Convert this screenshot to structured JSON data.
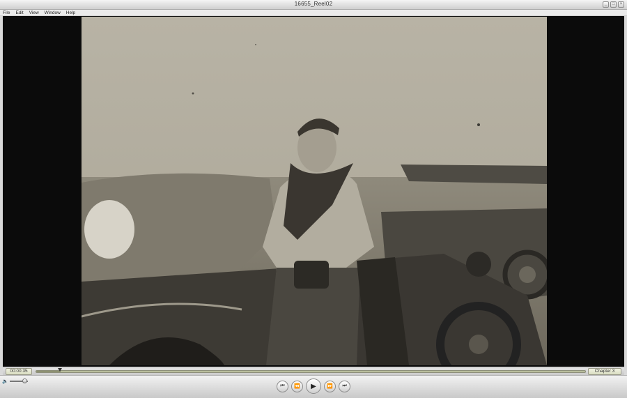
{
  "window": {
    "title": "16655_Reel02"
  },
  "title_controls": [
    "_",
    "□",
    "×"
  ],
  "menu": [
    "File",
    "Edit",
    "View",
    "Window",
    "Help"
  ],
  "playback": {
    "current_time": "00:00:35",
    "progress": 0.044,
    "chapter": "Chapter 3"
  },
  "volume": {
    "level": 0.85
  },
  "transport": {
    "prev_chapter": "⏮",
    "rewind": "⏪",
    "play": "▶",
    "fast_forward": "⏩",
    "next_chapter": "⏭"
  },
  "icons": {
    "volume": "speaker-icon",
    "playhead": "playhead-icon"
  },
  "colors": {
    "timeline_bg": "#d9ddc1",
    "video_bg": "#0b0b0b"
  }
}
